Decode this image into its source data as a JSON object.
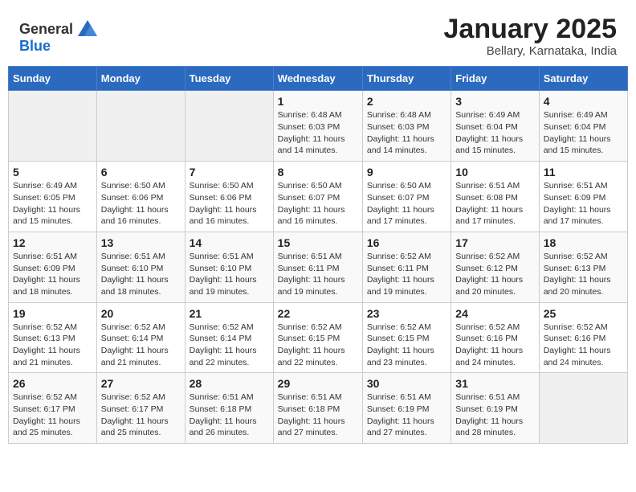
{
  "header": {
    "logo_general": "General",
    "logo_blue": "Blue",
    "month_title": "January 2025",
    "subtitle": "Bellary, Karnataka, India"
  },
  "days_of_week": [
    "Sunday",
    "Monday",
    "Tuesday",
    "Wednesday",
    "Thursday",
    "Friday",
    "Saturday"
  ],
  "weeks": [
    [
      {
        "day": "",
        "info": ""
      },
      {
        "day": "",
        "info": ""
      },
      {
        "day": "",
        "info": ""
      },
      {
        "day": "1",
        "info": "Sunrise: 6:48 AM\nSunset: 6:03 PM\nDaylight: 11 hours and 14 minutes."
      },
      {
        "day": "2",
        "info": "Sunrise: 6:48 AM\nSunset: 6:03 PM\nDaylight: 11 hours and 14 minutes."
      },
      {
        "day": "3",
        "info": "Sunrise: 6:49 AM\nSunset: 6:04 PM\nDaylight: 11 hours and 15 minutes."
      },
      {
        "day": "4",
        "info": "Sunrise: 6:49 AM\nSunset: 6:04 PM\nDaylight: 11 hours and 15 minutes."
      }
    ],
    [
      {
        "day": "5",
        "info": "Sunrise: 6:49 AM\nSunset: 6:05 PM\nDaylight: 11 hours and 15 minutes."
      },
      {
        "day": "6",
        "info": "Sunrise: 6:50 AM\nSunset: 6:06 PM\nDaylight: 11 hours and 16 minutes."
      },
      {
        "day": "7",
        "info": "Sunrise: 6:50 AM\nSunset: 6:06 PM\nDaylight: 11 hours and 16 minutes."
      },
      {
        "day": "8",
        "info": "Sunrise: 6:50 AM\nSunset: 6:07 PM\nDaylight: 11 hours and 16 minutes."
      },
      {
        "day": "9",
        "info": "Sunrise: 6:50 AM\nSunset: 6:07 PM\nDaylight: 11 hours and 17 minutes."
      },
      {
        "day": "10",
        "info": "Sunrise: 6:51 AM\nSunset: 6:08 PM\nDaylight: 11 hours and 17 minutes."
      },
      {
        "day": "11",
        "info": "Sunrise: 6:51 AM\nSunset: 6:09 PM\nDaylight: 11 hours and 17 minutes."
      }
    ],
    [
      {
        "day": "12",
        "info": "Sunrise: 6:51 AM\nSunset: 6:09 PM\nDaylight: 11 hours and 18 minutes."
      },
      {
        "day": "13",
        "info": "Sunrise: 6:51 AM\nSunset: 6:10 PM\nDaylight: 11 hours and 18 minutes."
      },
      {
        "day": "14",
        "info": "Sunrise: 6:51 AM\nSunset: 6:10 PM\nDaylight: 11 hours and 19 minutes."
      },
      {
        "day": "15",
        "info": "Sunrise: 6:51 AM\nSunset: 6:11 PM\nDaylight: 11 hours and 19 minutes."
      },
      {
        "day": "16",
        "info": "Sunrise: 6:52 AM\nSunset: 6:11 PM\nDaylight: 11 hours and 19 minutes."
      },
      {
        "day": "17",
        "info": "Sunrise: 6:52 AM\nSunset: 6:12 PM\nDaylight: 11 hours and 20 minutes."
      },
      {
        "day": "18",
        "info": "Sunrise: 6:52 AM\nSunset: 6:13 PM\nDaylight: 11 hours and 20 minutes."
      }
    ],
    [
      {
        "day": "19",
        "info": "Sunrise: 6:52 AM\nSunset: 6:13 PM\nDaylight: 11 hours and 21 minutes."
      },
      {
        "day": "20",
        "info": "Sunrise: 6:52 AM\nSunset: 6:14 PM\nDaylight: 11 hours and 21 minutes."
      },
      {
        "day": "21",
        "info": "Sunrise: 6:52 AM\nSunset: 6:14 PM\nDaylight: 11 hours and 22 minutes."
      },
      {
        "day": "22",
        "info": "Sunrise: 6:52 AM\nSunset: 6:15 PM\nDaylight: 11 hours and 22 minutes."
      },
      {
        "day": "23",
        "info": "Sunrise: 6:52 AM\nSunset: 6:15 PM\nDaylight: 11 hours and 23 minutes."
      },
      {
        "day": "24",
        "info": "Sunrise: 6:52 AM\nSunset: 6:16 PM\nDaylight: 11 hours and 24 minutes."
      },
      {
        "day": "25",
        "info": "Sunrise: 6:52 AM\nSunset: 6:16 PM\nDaylight: 11 hours and 24 minutes."
      }
    ],
    [
      {
        "day": "26",
        "info": "Sunrise: 6:52 AM\nSunset: 6:17 PM\nDaylight: 11 hours and 25 minutes."
      },
      {
        "day": "27",
        "info": "Sunrise: 6:52 AM\nSunset: 6:17 PM\nDaylight: 11 hours and 25 minutes."
      },
      {
        "day": "28",
        "info": "Sunrise: 6:51 AM\nSunset: 6:18 PM\nDaylight: 11 hours and 26 minutes."
      },
      {
        "day": "29",
        "info": "Sunrise: 6:51 AM\nSunset: 6:18 PM\nDaylight: 11 hours and 27 minutes."
      },
      {
        "day": "30",
        "info": "Sunrise: 6:51 AM\nSunset: 6:19 PM\nDaylight: 11 hours and 27 minutes."
      },
      {
        "day": "31",
        "info": "Sunrise: 6:51 AM\nSunset: 6:19 PM\nDaylight: 11 hours and 28 minutes."
      },
      {
        "day": "",
        "info": ""
      }
    ]
  ]
}
